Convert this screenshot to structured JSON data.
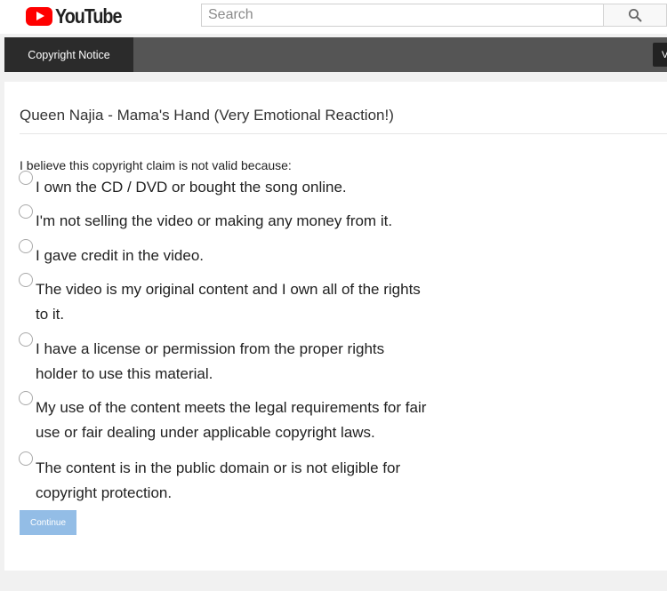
{
  "masthead": {
    "logo_text": "YouTube",
    "search_placeholder": "Search"
  },
  "navbar": {
    "active_tab": "Copyright Notice",
    "right_button": "Vi"
  },
  "card": {
    "video_title": "Queen Najia - Mama's Hand (Very Emotional Reaction!)",
    "prompt": "I believe this copyright claim is not valid because:",
    "options": [
      "I own the CD / DVD or bought the song online.",
      "I'm not selling the video or making any money from it.",
      "I gave credit in the video.",
      "The video is my original content and I own all of the rights to it.",
      "I have a license or permission from the proper rights holder to use this material.",
      "My use of the content meets the legal requirements for fair use or fair dealing under applicable copyright laws.",
      "The content is in the public domain or is not eligible for copyright protection."
    ],
    "continue_label": "Continue"
  },
  "colors": {
    "brand_red": "#ff0000",
    "nav_bar": "#555555",
    "nav_active": "#2b2b2b",
    "continue_disabled": "#93bde6"
  },
  "icons": {
    "logo": "youtube-play-icon",
    "search": "search-icon"
  }
}
